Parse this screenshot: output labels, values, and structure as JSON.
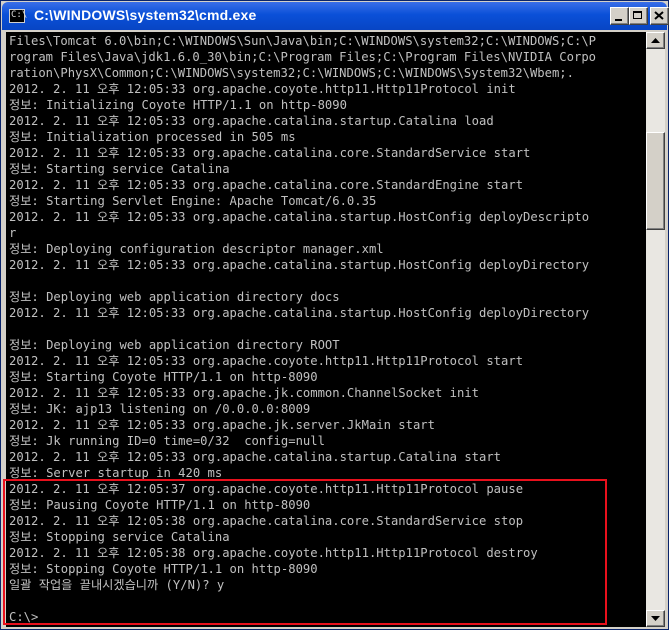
{
  "window": {
    "title": "C:\\WINDOWS\\system32\\cmd.exe",
    "icon_label": "C:\\"
  },
  "console": {
    "lines": [
      "Files\\Tomcat 6.0\\bin;C:\\WINDOWS\\Sun\\Java\\bin;C:\\WINDOWS\\system32;C:\\WINDOWS;C:\\P",
      "rogram Files\\Java\\jdk1.6.0_30\\bin;C:\\Program Files;C:\\Program Files\\NVIDIA Corpo",
      "ration\\PhysX\\Common;C:\\WINDOWS\\system32;C:\\WINDOWS;C:\\WINDOWS\\System32\\Wbem;.",
      "2012. 2. 11 오후 12:05:33 org.apache.coyote.http11.Http11Protocol init",
      "정보: Initializing Coyote HTTP/1.1 on http-8090",
      "2012. 2. 11 오후 12:05:33 org.apache.catalina.startup.Catalina load",
      "정보: Initialization processed in 505 ms",
      "2012. 2. 11 오후 12:05:33 org.apache.catalina.core.StandardService start",
      "정보: Starting service Catalina",
      "2012. 2. 11 오후 12:05:33 org.apache.catalina.core.StandardEngine start",
      "정보: Starting Servlet Engine: Apache Tomcat/6.0.35",
      "2012. 2. 11 오후 12:05:33 org.apache.catalina.startup.HostConfig deployDescripto",
      "r",
      "정보: Deploying configuration descriptor manager.xml",
      "2012. 2. 11 오후 12:05:33 org.apache.catalina.startup.HostConfig deployDirectory",
      "",
      "정보: Deploying web application directory docs",
      "2012. 2. 11 오후 12:05:33 org.apache.catalina.startup.HostConfig deployDirectory",
      "",
      "정보: Deploying web application directory ROOT",
      "2012. 2. 11 오후 12:05:33 org.apache.coyote.http11.Http11Protocol start",
      "정보: Starting Coyote HTTP/1.1 on http-8090",
      "2012. 2. 11 오후 12:05:33 org.apache.jk.common.ChannelSocket init",
      "정보: JK: ajp13 listening on /0.0.0.0:8009",
      "2012. 2. 11 오후 12:05:33 org.apache.jk.server.JkMain start",
      "정보: Jk running ID=0 time=0/32  config=null",
      "2012. 2. 11 오후 12:05:33 org.apache.catalina.startup.Catalina start",
      "정보: Server startup in 420 ms",
      "2012. 2. 11 오후 12:05:37 org.apache.coyote.http11.Http11Protocol pause",
      "정보: Pausing Coyote HTTP/1.1 on http-8090",
      "2012. 2. 11 오후 12:05:38 org.apache.catalina.core.StandardService stop",
      "정보: Stopping service Catalina",
      "2012. 2. 11 오후 12:05:38 org.apache.coyote.http11.Http11Protocol destroy",
      "정보: Stopping Coyote HTTP/1.1 on http-8090",
      "일괄 작업을 끝내시겠습니까 (Y/N)? y",
      "",
      "C:\\>"
    ]
  },
  "colors": {
    "console_bg": "#000000",
    "console_fg": "#c0c0c0",
    "titlebar": "#0a50d8",
    "highlight_border": "#e8101c"
  },
  "icons": {
    "minimize": "minimize-icon",
    "maximize": "maximize-icon",
    "close": "close-icon",
    "scroll_up": "arrow-up-icon",
    "scroll_down": "arrow-down-icon"
  }
}
